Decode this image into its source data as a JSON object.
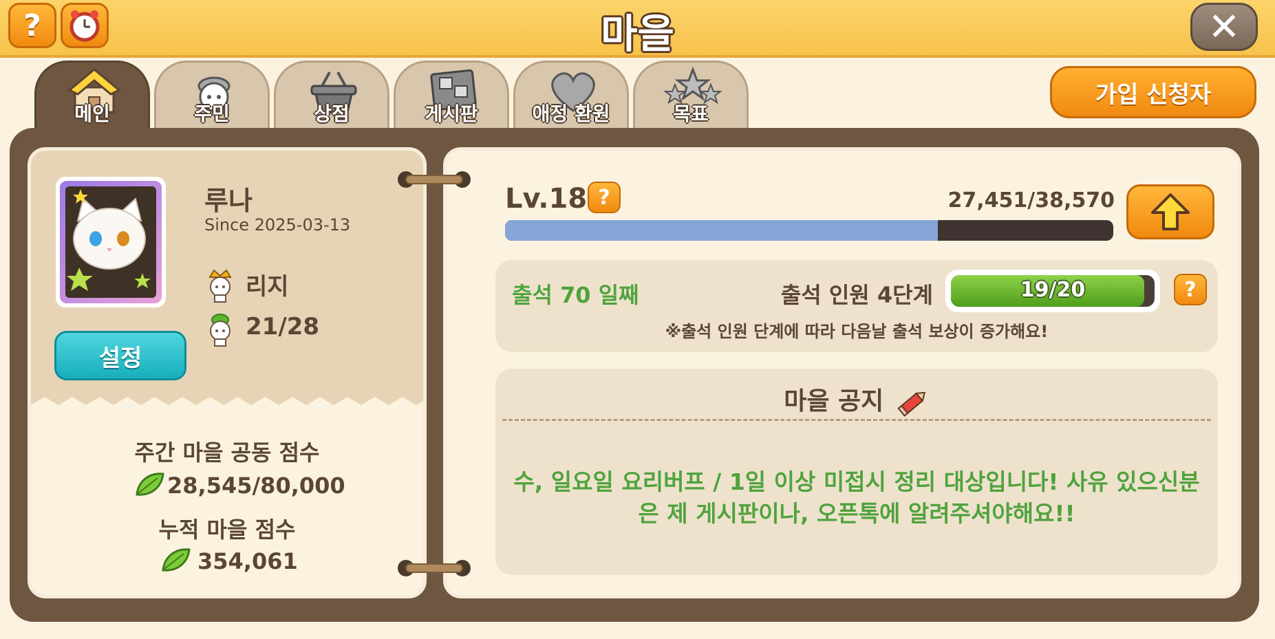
{
  "header": {
    "title": "마을",
    "help_label": "?",
    "alarm_icon": "alarm-clock-icon",
    "close_label": "✕"
  },
  "tabs": [
    {
      "label": "메인",
      "icon": "house-icon",
      "active": true
    },
    {
      "label": "주민",
      "icon": "resident-icon",
      "active": false
    },
    {
      "label": "상점",
      "icon": "basket-icon",
      "active": false
    },
    {
      "label": "게시판",
      "icon": "board-icon",
      "active": false
    },
    {
      "label": "애정 환원",
      "icon": "heart-icon",
      "active": false
    },
    {
      "label": "목표",
      "icon": "stars-icon",
      "active": false
    }
  ],
  "applicant_button": "가입 신청자",
  "village": {
    "name": "루나",
    "since": "Since 2025-03-13",
    "leader": "리지",
    "members": "21/28",
    "settings_label": "설정"
  },
  "scores": {
    "weekly_title": "주간 마을 공동 점수",
    "weekly_value": "28,545/80,000",
    "total_title": "누적 마을 점수",
    "total_value": "354,061"
  },
  "level": {
    "label": "Lv.18",
    "exp": "27,451/38,570",
    "exp_fraction": 0.712,
    "help_label": "?"
  },
  "attendance": {
    "days": "출석 70 일째",
    "stage": "출석 인원 4단계",
    "progress": "19/20",
    "progress_fraction": 0.95,
    "note": "※출석 인원 단계에 따라 다음날 출석 보상이 증가해요!",
    "help_label": "?"
  },
  "notice": {
    "title": "마을 공지",
    "text": "수, 일요일 요리버프 / 1일 이상 미접시 정리 대상입니다! 사유 있으신분은 제 게시판이나, 오픈톡에 알려주셔야해요!!"
  },
  "colors": {
    "accent_orange": "#f08a10",
    "header_yellow": "#f7c24a",
    "frame_brown": "#6e5640",
    "text_green": "#4fa33e",
    "teal": "#18aebc"
  }
}
